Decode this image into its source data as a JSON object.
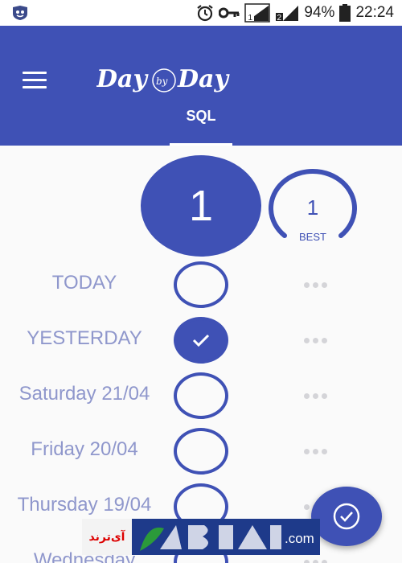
{
  "status_bar": {
    "battery": "94%",
    "time": "22:24",
    "sim1": "1",
    "sim2": "2",
    "icons": [
      "app-badge-icon",
      "alarm-clock-icon",
      "key-icon",
      "signal-icon",
      "signal-icon",
      "battery-icon"
    ]
  },
  "app": {
    "logo_text": "Day by Day",
    "tab_label": "SQL",
    "accent_color": "#3f51b5"
  },
  "counters": {
    "current": "1",
    "best_value": "1",
    "best_label": "BEST"
  },
  "days": [
    {
      "label": "TODAY",
      "checked": false
    },
    {
      "label": "YESTERDAY",
      "checked": true
    },
    {
      "label": "Saturday 21/04",
      "checked": false
    },
    {
      "label": "Friday 20/04",
      "checked": false
    },
    {
      "label": "Thursday 19/04",
      "checked": false
    },
    {
      "label": "Wednesday",
      "checked": false
    }
  ],
  "watermark": {
    "left_text": "آی‌ترند",
    "right_text": ".com"
  }
}
